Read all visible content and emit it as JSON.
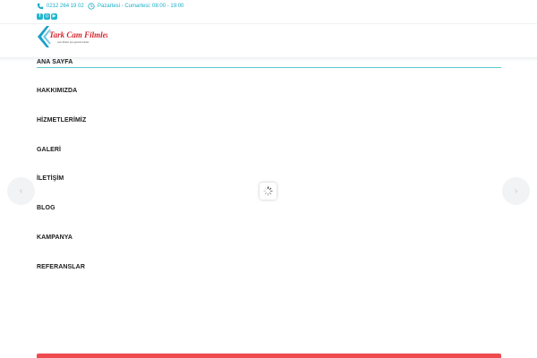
{
  "topbar": {
    "phone": "0212 264 19 02",
    "hours": "Pazartesi - Cumartesi: 08:00 - 19:00"
  },
  "social": {
    "facebook_glyph": "f",
    "instagram_glyph": "◎",
    "youtube_glyph": "▶"
  },
  "logo": {
    "name": "Tark Cam Filmleri",
    "tagline": "cam filmleri için güvenli ürünler"
  },
  "menu": {
    "items": [
      {
        "label": "ANA SAYFA"
      },
      {
        "label": "HAKKIMIZDA"
      },
      {
        "label": "HİZMETLERİMİZ"
      },
      {
        "label": "GALERİ"
      },
      {
        "label": "İLETİŞİM"
      },
      {
        "label": "BLOG"
      },
      {
        "label": "KAMPANYA"
      },
      {
        "label": "REFERANSLAR"
      }
    ]
  },
  "slider": {
    "prev_icon": "chevron-left-icon",
    "next_icon": "chevron-right-icon",
    "prev_glyph": "‹",
    "next_glyph": "›"
  },
  "colors": {
    "accent": "#1aaec7",
    "active_underline": "#5ec7d1",
    "logo_red": "#d6262f",
    "logo_blue": "#1a9fc9",
    "bottom_bar": "#ef4b4f"
  }
}
